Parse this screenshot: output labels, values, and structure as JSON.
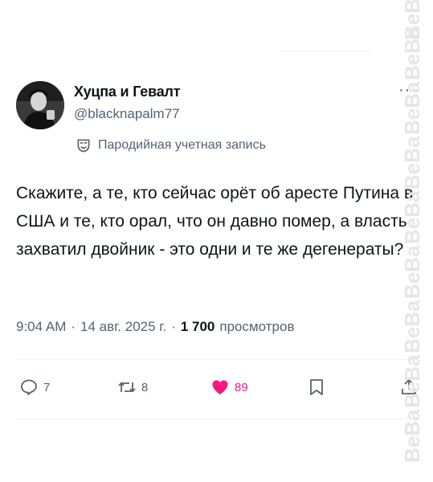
{
  "tweet": {
    "author_name": "Хуцпа и Гевалт",
    "author_handle": "@blacknapalm77",
    "parody_label": "Пародийная учетная запись",
    "text": "Скажите, а те, кто сейчас орёт об аресте Путина в США и те, кто орал, что он давно помер, а власть захватил двойник - это одни и те же дегенераты?",
    "time": "9:04 AM",
    "date": "14 авг. 2025 г.",
    "views_count": "1 700",
    "views_label": "просмотров",
    "more_label": "···"
  },
  "actions": {
    "replies": "7",
    "reposts": "8",
    "likes": "89",
    "like_color": "#f91880"
  },
  "watermark": {
    "text": "BeBa"
  },
  "icons": {
    "reply": "reply-icon",
    "repost": "repost-icon",
    "like": "heart-icon",
    "bookmark": "bookmark-icon",
    "share": "share-icon",
    "parody": "mask-icon"
  }
}
